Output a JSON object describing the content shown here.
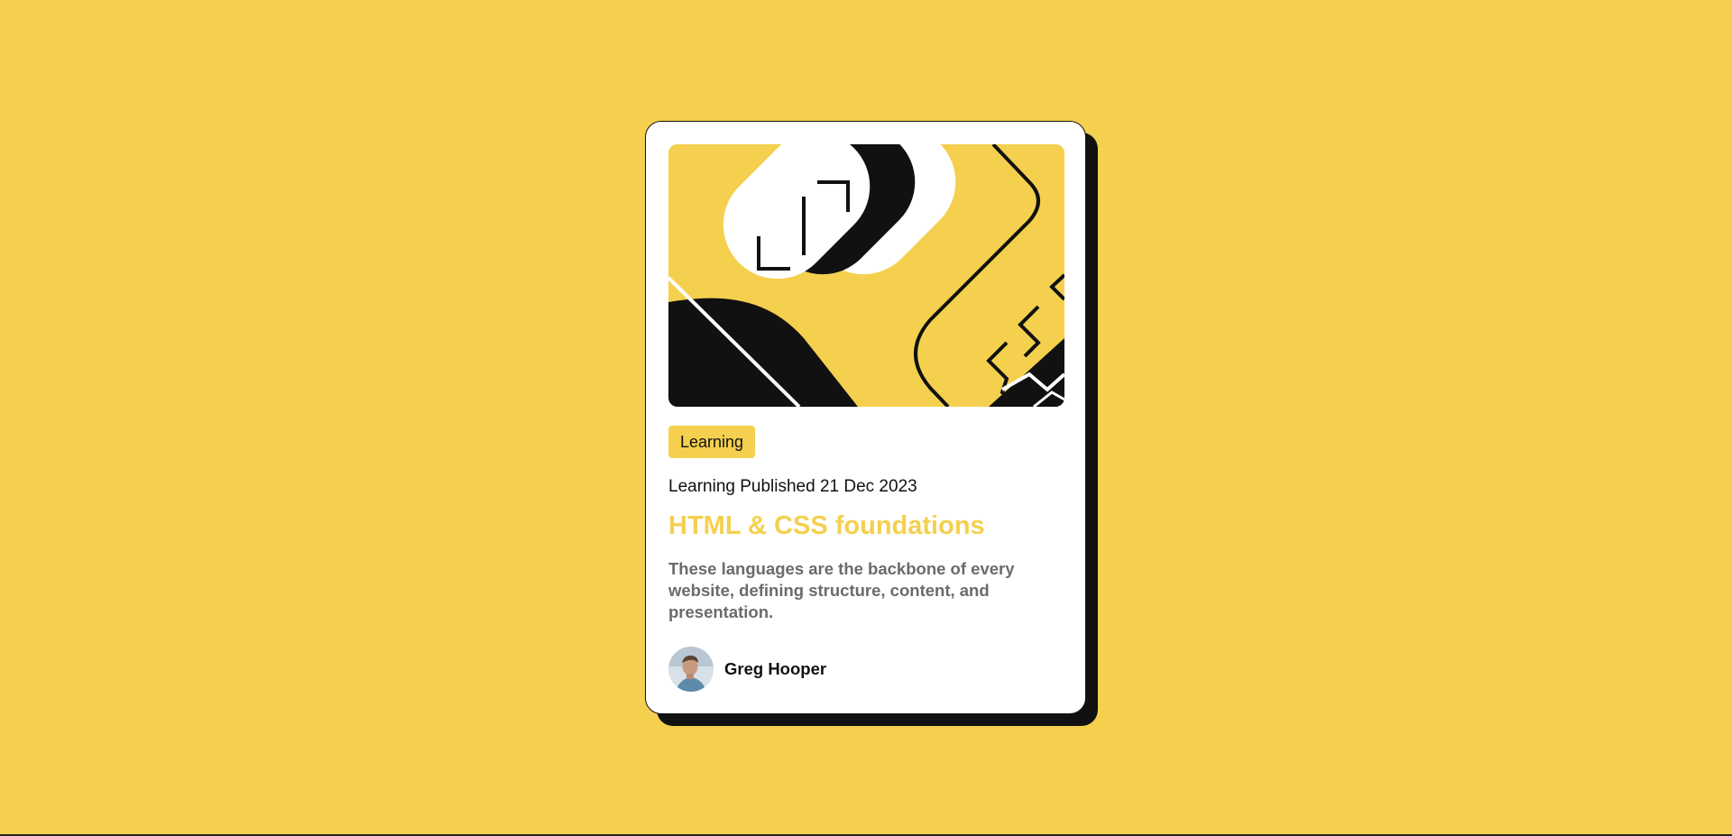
{
  "colors": {
    "background": "#f4d04e",
    "card": "#ffffff",
    "ink": "#111111",
    "accent": "#f4d04e",
    "summary_text": "#6b6b6b"
  },
  "card": {
    "illustration_icon": "abstract-yellow-illustration",
    "category": "Learning",
    "published": "Learning Published 21 Dec 2023",
    "title": "HTML & CSS foundations",
    "summary": "These languages are the backbone of every website, defining structure, content, and presentation.",
    "author": {
      "avatar_icon": "author-avatar",
      "name": "Greg Hooper"
    }
  }
}
